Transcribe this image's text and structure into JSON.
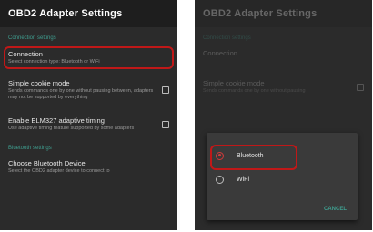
{
  "left_screen": {
    "toolbar_title": "OBD2 Adapter Settings",
    "section_connection": "Connection settings",
    "connection": {
      "title": "Connection",
      "summary": "Select connection type: Bluetooth or WiFi"
    },
    "cookie_mode": {
      "title": "Simple cookie mode",
      "summary": "Sends commands one by one without pausing between, adapters may not be supported by everything"
    },
    "elm327_timing": {
      "title": "Enable ELM327 adaptive timing",
      "summary": "Use adaptive timing feature supported by some adapters"
    },
    "section_bluetooth": "Bluetooth settings",
    "bt_device": {
      "title": "Choose Bluetooth Device",
      "summary": "Select the OBD2 adapter device to connect to"
    }
  },
  "right_screen": {
    "toolbar_title": "OBD2 Adapter Settings",
    "section_connection": "Connection settings",
    "connection": {
      "title": "Connection"
    },
    "cookie_mode": {
      "title": "Simple cookie mode",
      "summary": "Sends commands one by one without pausing"
    },
    "dialog": {
      "options": [
        {
          "label": "Bluetooth",
          "selected": true
        },
        {
          "label": "WiFi",
          "selected": false
        }
      ],
      "cancel_label": "CANCEL"
    }
  },
  "colors": {
    "accent": "#3f9e8f",
    "highlight": "#c01818",
    "background": "#2b2b2b"
  }
}
